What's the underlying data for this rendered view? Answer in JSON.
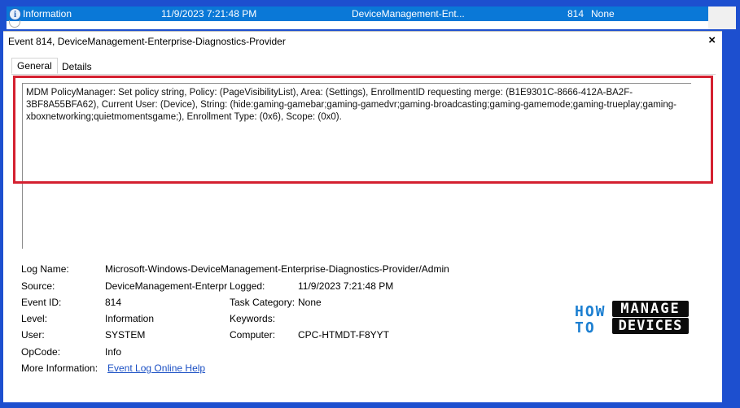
{
  "event_list": {
    "selected_row": {
      "level": "Information",
      "date_time": "11/9/2023 7:21:48 PM",
      "source": "DeviceManagement-Ent...",
      "event_id": "814",
      "task_category": "None"
    }
  },
  "details_panel": {
    "title": "Event 814, DeviceManagement-Enterprise-Diagnostics-Provider",
    "close_label": "×",
    "tabs": [
      "General",
      "Details"
    ],
    "description": "MDM PolicyManager: Set policy string, Policy: (PageVisibilityList), Area: (Settings), EnrollmentID requesting merge: (B1E9301C-8666-412A-BA2F-3BF8A55BFA62), Current User: (Device), String: (hide:gaming-gamebar;gaming-gamedvr;gaming-broadcasting;gaming-gamemode;gaming-trueplay;gaming-xboxnetworking;quietmomentsgame;), Enrollment Type: (0x6), Scope: (0x0).",
    "properties": {
      "log_name_label": "Log Name:",
      "log_name": "Microsoft-Windows-DeviceManagement-Enterprise-Diagnostics-Provider/Admin",
      "source_label": "Source:",
      "source": "DeviceManagement-Enterpr",
      "logged_label": "Logged:",
      "logged": "11/9/2023 7:21:48 PM",
      "event_id_label": "Event ID:",
      "event_id": "814",
      "task_category_label": "Task Category:",
      "task_category": "None",
      "level_label": "Level:",
      "level": "Information",
      "keywords_label": "Keywords:",
      "keywords": "",
      "user_label": "User:",
      "user": "SYSTEM",
      "computer_label": "Computer:",
      "computer": "CPC-HTMDT-F8YYT",
      "opcode_label": "OpCode:",
      "opcode": "Info",
      "more_info_label": "More Information:",
      "more_info_link": "Event Log Online Help"
    }
  },
  "watermark": {
    "how": "HOW",
    "to": "TO",
    "manage": "MANAGE",
    "devices": "DEVICES"
  },
  "colors": {
    "frame": "#1d4fcf",
    "selection": "#0a78d7",
    "highlight_box": "#d42030",
    "link": "#1a4fc4"
  }
}
